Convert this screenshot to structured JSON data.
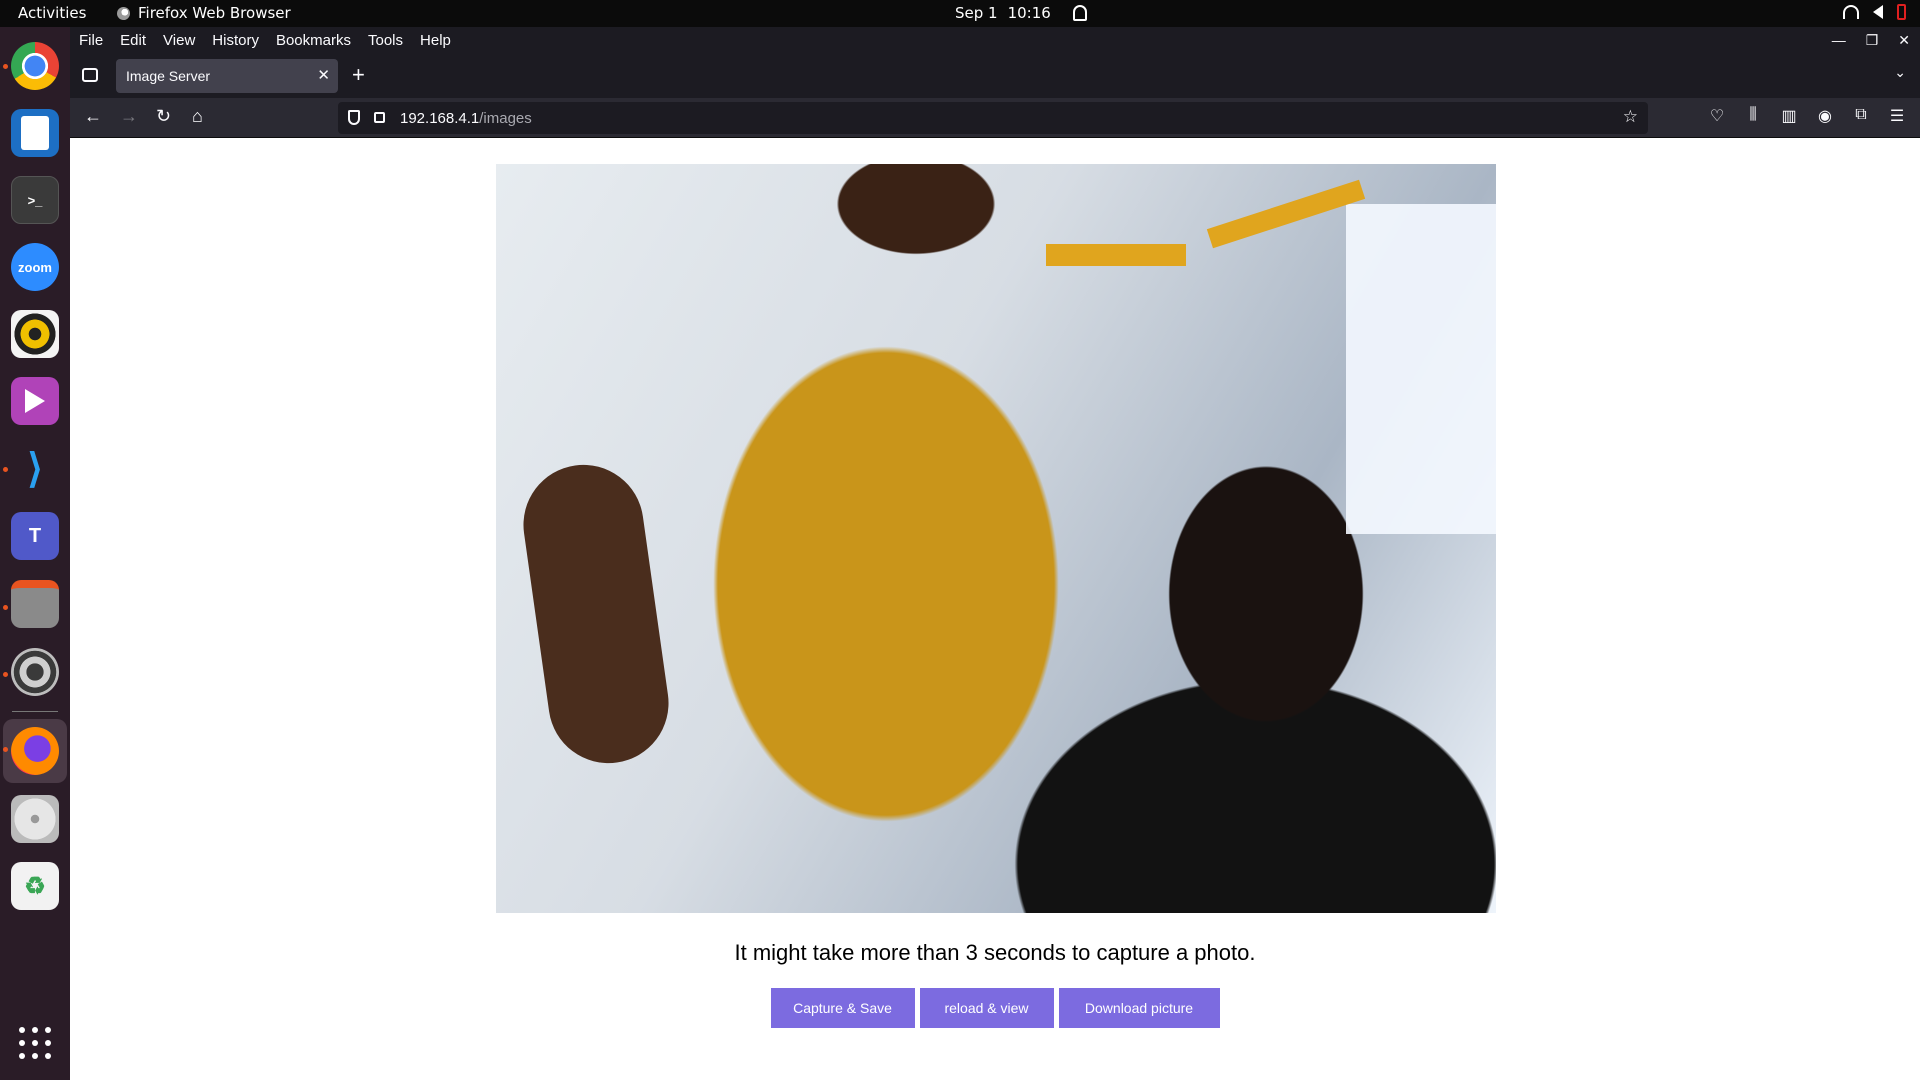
{
  "topbar": {
    "activities": "Activities",
    "app_name": "Firefox Web Browser",
    "date": "Sep 1",
    "time": "10:16"
  },
  "dock": {
    "apps": [
      "Google Chrome",
      "LibreOffice Writer",
      "Terminal",
      "Zoom",
      "Rhythmbox",
      "Videos",
      "Visual Studio Code",
      "Microsoft Teams",
      "Files",
      "Settings",
      "Firefox",
      "Disks",
      "Trash"
    ],
    "zoom_label": "zoom",
    "terminal_label": ">_",
    "teams_label": "T",
    "trash_label": "♻"
  },
  "menubar": {
    "items": [
      "File",
      "Edit",
      "View",
      "History",
      "Bookmarks",
      "Tools",
      "Help"
    ]
  },
  "tabs": [
    {
      "label": "Image Server",
      "active": true
    }
  ],
  "navbar": {
    "url_host": "192.168.4.1",
    "url_path": "/images"
  },
  "page": {
    "caption": "It might take more than 3 seconds to capture a photo.",
    "buttons": {
      "capture": "Capture & Save",
      "reload": "reload & view",
      "download": "Download picture"
    },
    "button_color": "#7c6be0"
  },
  "colors": {
    "topbar_bg": "#0b0b0b",
    "dock_bg": "#2a1c27",
    "browser_chrome": "#1c1b22",
    "toolbar": "#2b2a33",
    "accent_dot": "#e95420"
  }
}
